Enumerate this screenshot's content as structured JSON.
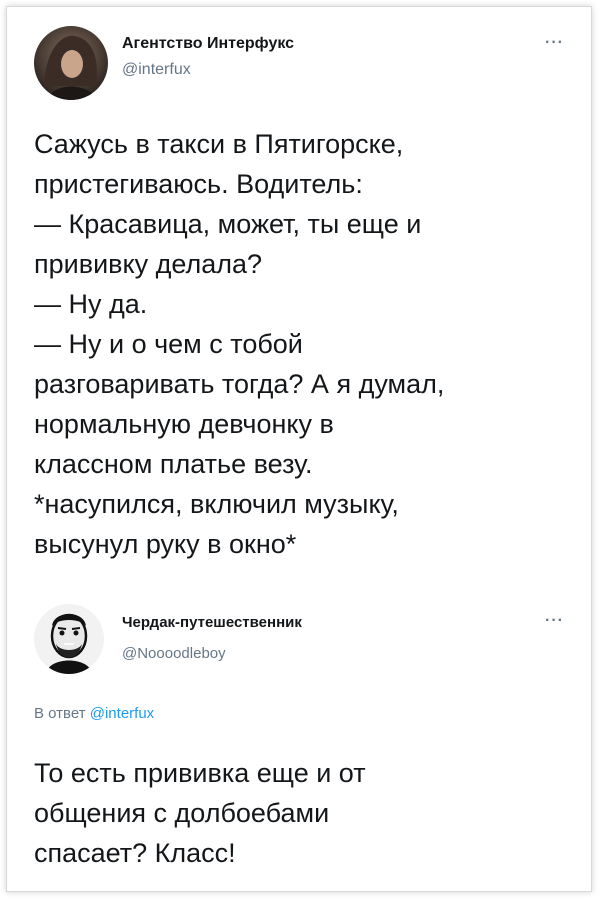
{
  "tweet1": {
    "author_name": "Агентство Интерфукс",
    "author_handle": "@interfux",
    "more_label": "···",
    "text_lines": [
      "Сажусь в такси в Пятигорске,",
      "пристегиваюсь. Водитель:",
      "— Красавица, может, ты еще и",
      "прививку делала?",
      "— Ну да.",
      "— Ну и о чем с тобой",
      "разговаривать тогда? А я думал,",
      "нормальную девчонку в",
      "классном платье везу.",
      "*насупился, включил музыку,",
      "высунул руку в окно*"
    ]
  },
  "tweet2": {
    "author_name": "Чердак-путешественник",
    "author_handle": "@Noooodleboy",
    "more_label": "···",
    "reply_prefix": "В ответ",
    "reply_handle": "@interfux",
    "text_lines": [
      "То есть прививка еще и от",
      "общения с долбоебами",
      "спасает? Класс!"
    ]
  },
  "colors": {
    "text": "#14171a",
    "secondary": "#657786",
    "link": "#1d9bf0"
  },
  "icons": [
    "more-icon",
    "avatar-image"
  ]
}
